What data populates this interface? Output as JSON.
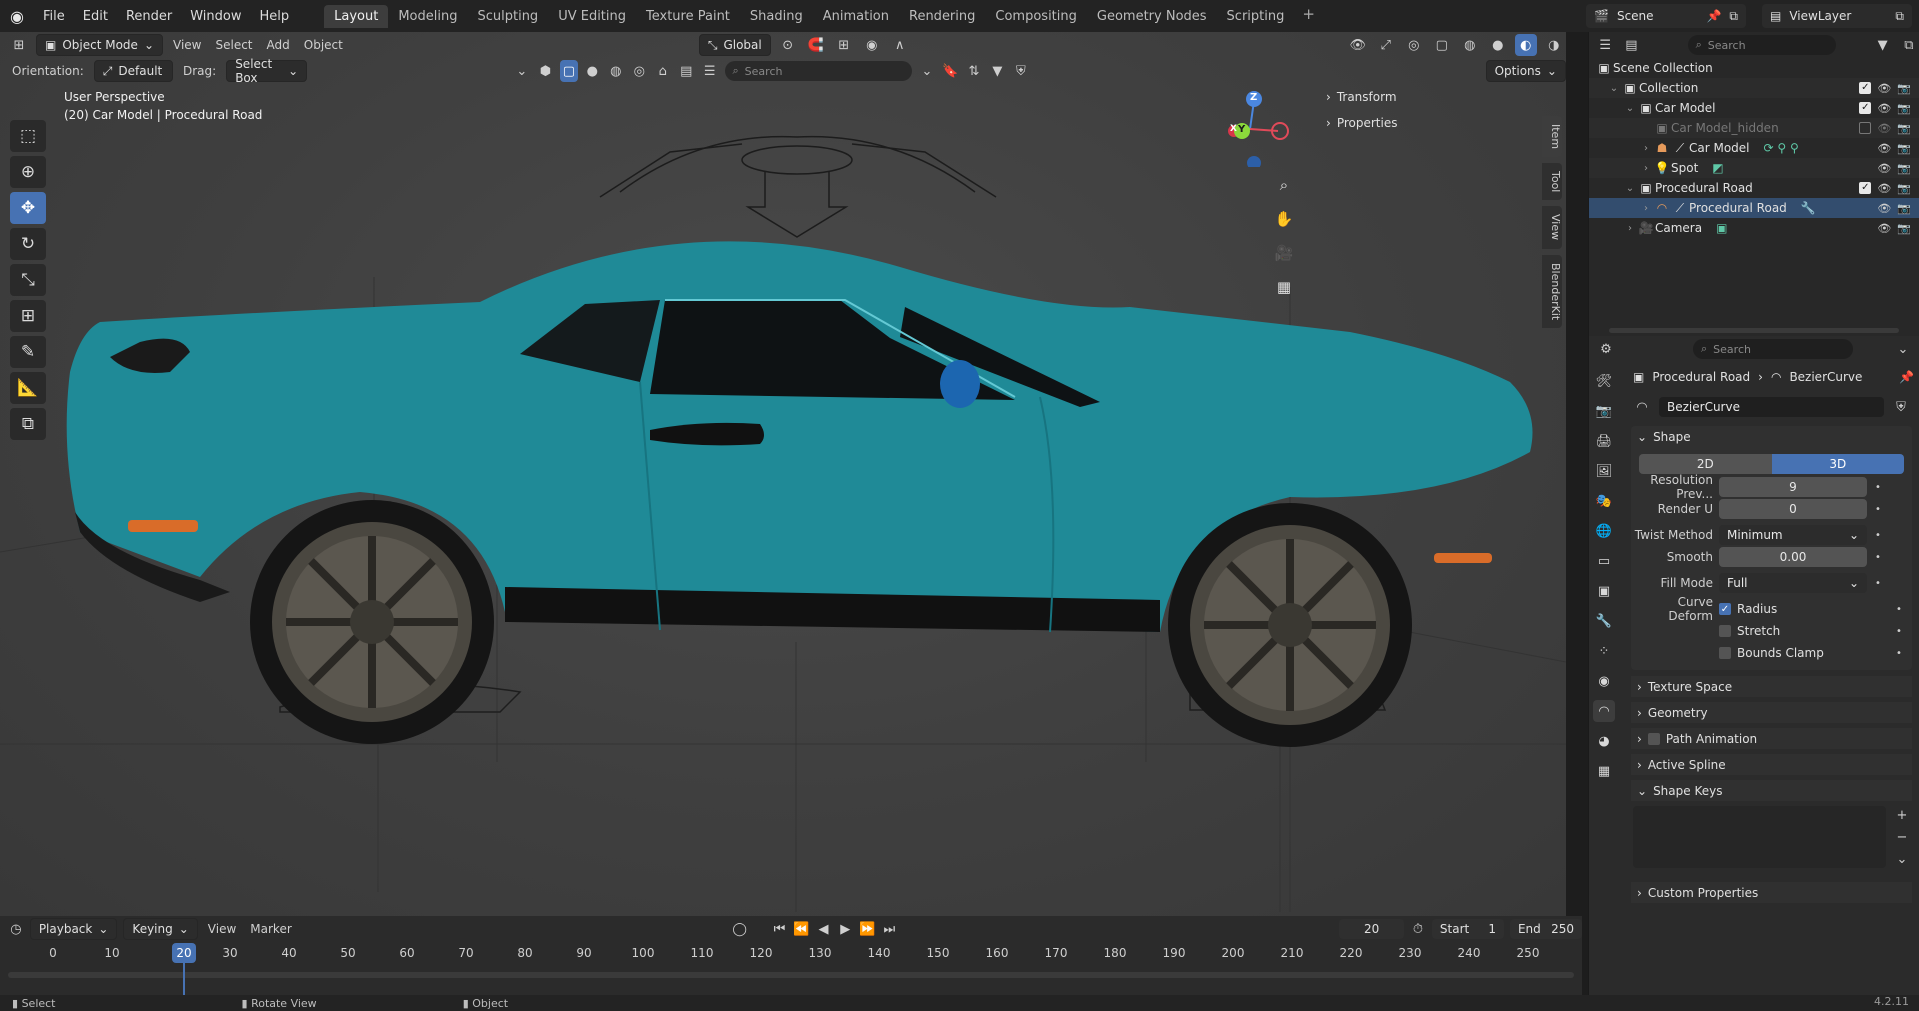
{
  "topbar": {
    "menus": [
      "File",
      "Edit",
      "Render",
      "Window",
      "Help"
    ],
    "workspaces": [
      "Layout",
      "Modeling",
      "Sculpting",
      "UV Editing",
      "Texture Paint",
      "Shading",
      "Animation",
      "Rendering",
      "Compositing",
      "Geometry Nodes",
      "Scripting"
    ],
    "active_workspace": "Layout",
    "scene": "Scene",
    "view_layer": "ViewLayer"
  },
  "viewport": {
    "mode": "Object Mode",
    "menus": [
      "View",
      "Select",
      "Add",
      "Object"
    ],
    "orientation_label": "Orientation:",
    "orientation_value": "Default",
    "drag_label": "Drag:",
    "drag_value": "Select Box",
    "transform_orientation": "Global",
    "search_placeholder": "Search",
    "options_label": "Options",
    "view_name": "User Perspective",
    "object_info": "(20) Car Model | Procedural Road",
    "npanel": [
      "Transform",
      "Properties"
    ],
    "side_tabs": [
      "Item",
      "Tool",
      "View",
      "BlenderKit"
    ],
    "gizmo_axes": {
      "x": "X",
      "y": "Y",
      "z": "Z"
    }
  },
  "timeline": {
    "menus": [
      "Playback",
      "Keying",
      "View",
      "Marker"
    ],
    "current_frame": "20",
    "start_label": "Start",
    "start": "1",
    "end_label": "End",
    "end": "250",
    "ticks": [
      "0",
      "10",
      "20",
      "30",
      "40",
      "50",
      "60",
      "70",
      "80",
      "90",
      "100",
      "110",
      "120",
      "130",
      "140",
      "150",
      "160",
      "170",
      "180",
      "190",
      "200",
      "210",
      "220",
      "230",
      "240",
      "250"
    ]
  },
  "statusbar": {
    "select": "Select",
    "rotate": "Rotate View",
    "object": "Object",
    "version": "4.2.11"
  },
  "outliner": {
    "search_placeholder": "Search",
    "rows": [
      {
        "label": "Scene Collection"
      },
      {
        "label": "Collection"
      },
      {
        "label": "Car Model"
      },
      {
        "label": "Car Model_hidden"
      },
      {
        "label": "Car Model"
      },
      {
        "label": "Spot"
      },
      {
        "label": "Procedural Road"
      },
      {
        "label": "Procedural Road"
      },
      {
        "label": "Camera"
      }
    ]
  },
  "properties": {
    "search_placeholder": "Search",
    "breadcrumb_object": "Procedural Road",
    "breadcrumb_data": "BezierCurve",
    "datablock_name": "BezierCurve",
    "shape_panel": "Shape",
    "dim_2d": "2D",
    "dim_3d": "3D",
    "resolution_preview_label": "Resolution Prev...",
    "resolution_preview": "9",
    "render_u_label": "Render U",
    "render_u": "0",
    "twist_method_label": "Twist Method",
    "twist_method": "Minimum",
    "smooth_label": "Smooth",
    "smooth": "0.00",
    "fill_mode_label": "Fill Mode",
    "fill_mode": "Full",
    "curve_deform_label": "Curve Deform",
    "radius_label": "Radius",
    "stretch_label": "Stretch",
    "bounds_clamp_label": "Bounds Clamp",
    "panels": [
      "Texture Space",
      "Geometry",
      "Path Animation",
      "Active Spline"
    ],
    "shape_keys_panel": "Shape Keys",
    "custom_properties_panel": "Custom Properties"
  }
}
